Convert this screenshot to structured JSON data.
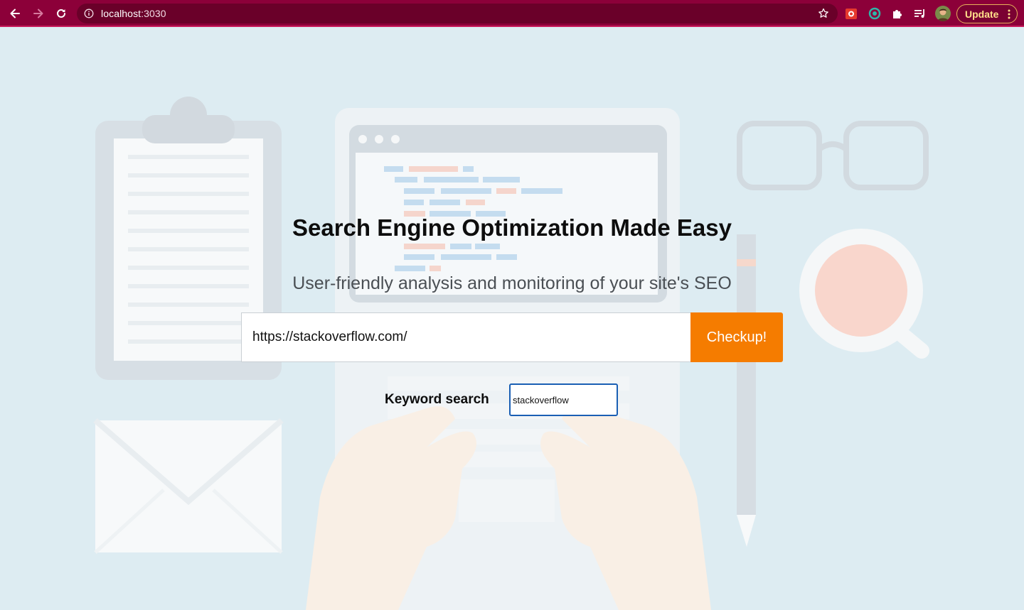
{
  "browser": {
    "url_host": "localhost",
    "url_port": ":3030",
    "update_label": "Update",
    "icons": {
      "back": "back-arrow-icon",
      "forward": "forward-arrow-icon",
      "reload": "reload-icon",
      "info": "site-info-icon",
      "star": "bookmark-star-icon",
      "extensions": "puzzle-icon",
      "media": "media-queue-icon",
      "profile": "avatar"
    },
    "colors": {
      "frame": "#8c0039",
      "omnibox": "#6a0029",
      "update_text": "#ffe08a"
    }
  },
  "hero": {
    "title": "Search Engine Optimization Made Easy",
    "subtitle": "User-friendly analysis and monitoring of your site's SEO"
  },
  "url_form": {
    "value": "https://stackoverflow.com/",
    "button_label": "Checkup!",
    "button_color": "#f57c00"
  },
  "keyword": {
    "label": "Keyword search",
    "value": "stackoverflow"
  }
}
